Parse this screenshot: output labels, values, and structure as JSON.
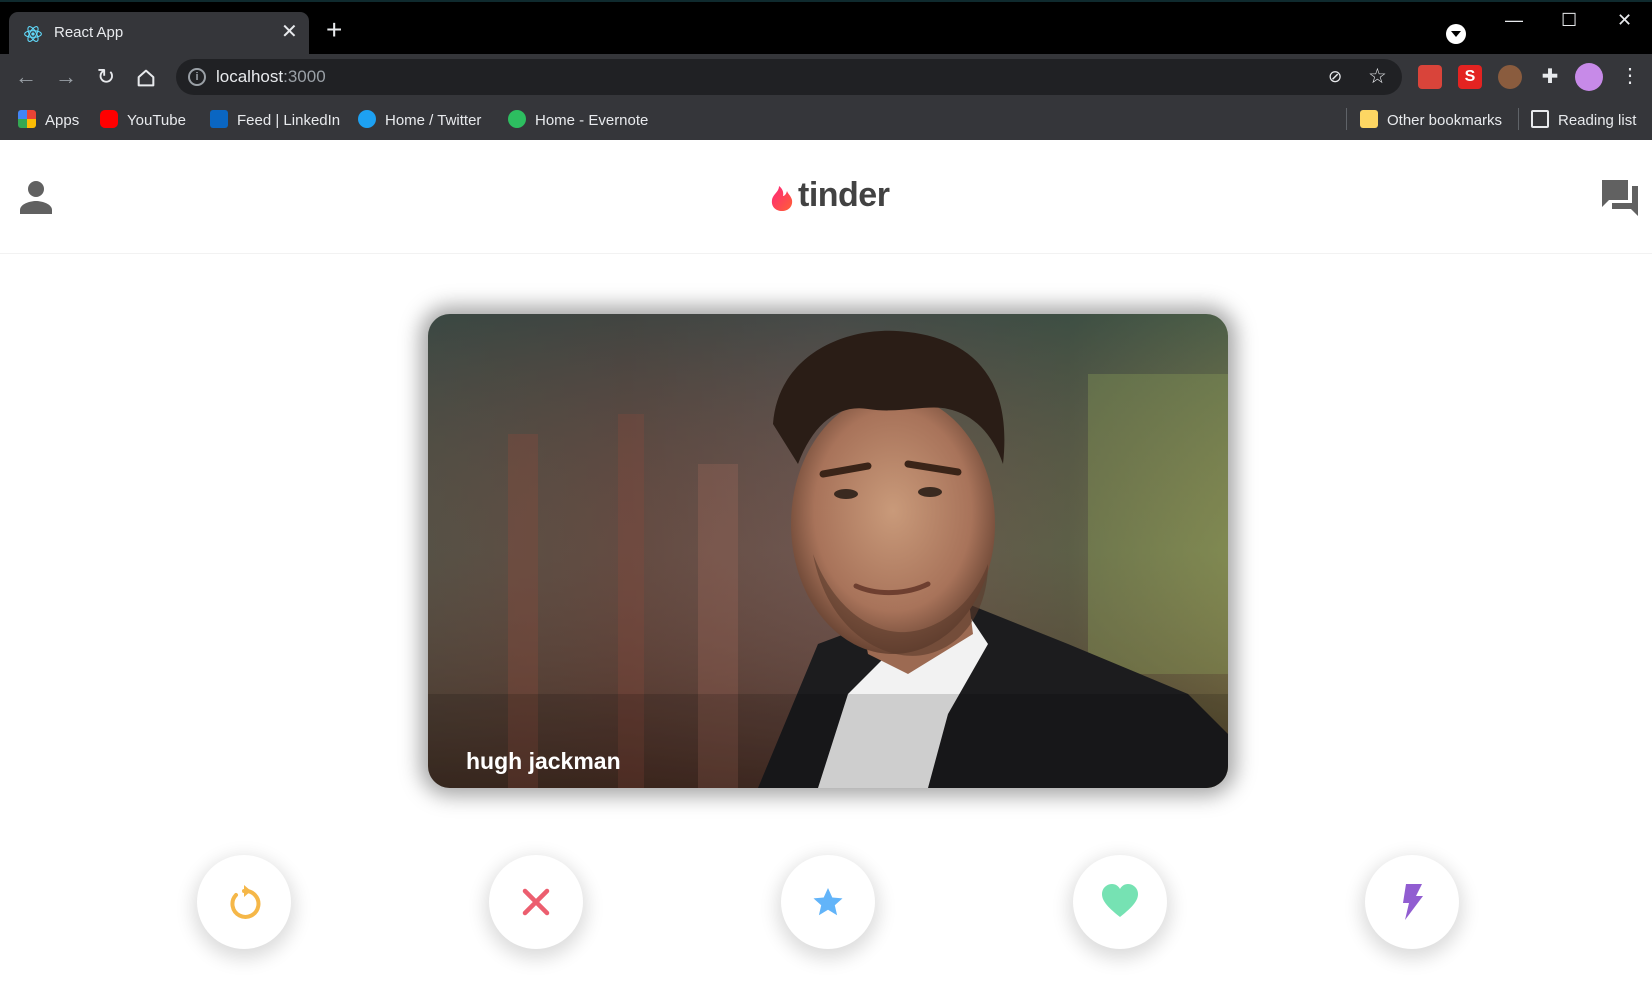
{
  "browser": {
    "tab": {
      "title": "React App",
      "favicon": "react-icon"
    },
    "new_tab_label": "+",
    "window_controls": {
      "minimize": "—",
      "maximize": "☐",
      "close": "✕"
    },
    "address": {
      "host": "localhost",
      "port": ":3000"
    },
    "bookmarks": [
      {
        "label": "Apps",
        "icon": "apps-grid-icon"
      },
      {
        "label": "YouTube",
        "icon": "youtube-icon"
      },
      {
        "label": "Feed | LinkedIn",
        "icon": "linkedin-icon"
      },
      {
        "label": "Home / Twitter",
        "icon": "twitter-icon"
      },
      {
        "label": "Home - Evernote",
        "icon": "evernote-icon"
      }
    ],
    "other_bookmarks": "Other bookmarks",
    "reading_list": "Reading list"
  },
  "app": {
    "logo_text": "tinder",
    "brand_color": "#fd5068",
    "card": {
      "name": "hugh jackman"
    },
    "actions": [
      {
        "name": "replay",
        "icon": "replay-icon",
        "color": "#f5b748"
      },
      {
        "name": "nope",
        "icon": "close-icon",
        "color": "#ec5e6f"
      },
      {
        "name": "super-like",
        "icon": "star-icon",
        "color": "#62b4f9"
      },
      {
        "name": "like",
        "icon": "heart-icon",
        "color": "#76e2b3"
      },
      {
        "name": "boost",
        "icon": "lightning-icon",
        "color": "#915dd1"
      }
    ]
  }
}
